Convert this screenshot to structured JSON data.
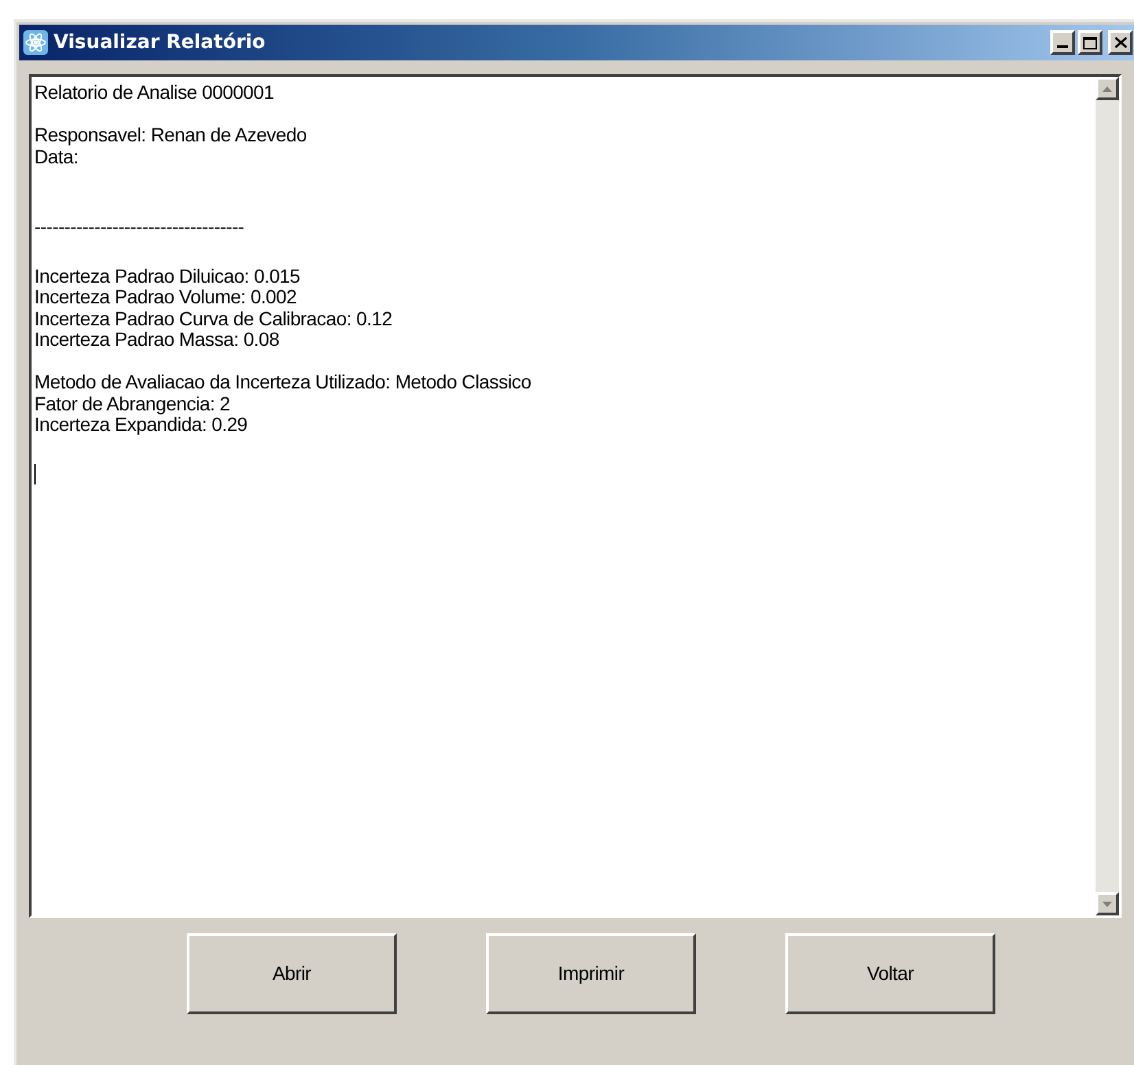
{
  "window": {
    "title": "Visualizar Relatório"
  },
  "report": {
    "blocks": [
      {
        "kind": "paragraph",
        "lines": [
          "Relatorio de Analise 0000001"
        ]
      },
      {
        "kind": "paragraph",
        "lines": [
          "Responsavel: Renan de Azevedo",
          "Data:"
        ]
      },
      {
        "kind": "separator",
        "lines": [
          "-----------------------------------"
        ]
      },
      {
        "kind": "paragraph",
        "lines": [
          "Incerteza Padrao Diluicao: 0.015",
          "Incerteza Padrao Volume: 0.002",
          "Incerteza Padrao Curva de Calibracao: 0.12",
          "Incerteza Padrao Massa: 0.08"
        ]
      },
      {
        "kind": "paragraph",
        "lines": [
          "Metodo de Avaliacao da Incerteza Utilizado: Metodo Classico",
          "Fator de Abrangencia: 2",
          "Incerteza Expandida: 0.29"
        ]
      }
    ]
  },
  "buttons": [
    "Abrir",
    "Imprimir",
    "Voltar"
  ]
}
